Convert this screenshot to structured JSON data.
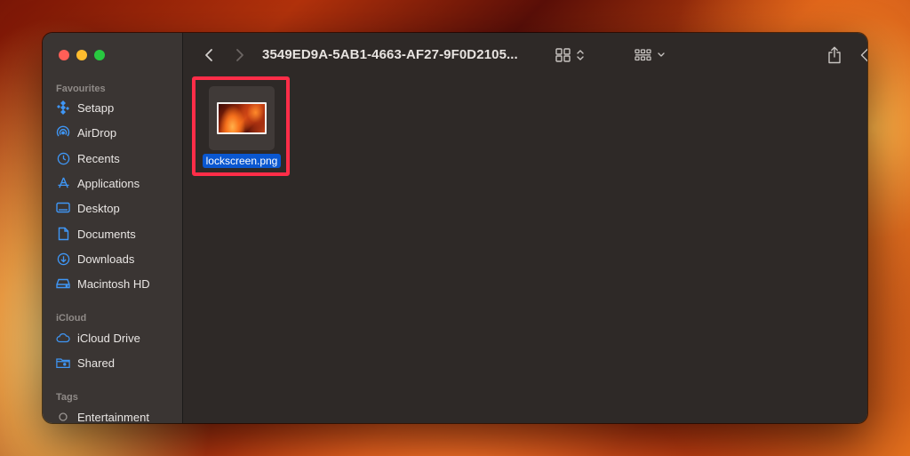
{
  "window": {
    "path_title": "3549ED9A-5AB1-4663-AF27-9F0D2105..."
  },
  "sidebar": {
    "sections": [
      {
        "title": "Favourites",
        "items": [
          {
            "label": "Setapp",
            "icon": "setapp-icon"
          },
          {
            "label": "AirDrop",
            "icon": "airdrop-icon"
          },
          {
            "label": "Recents",
            "icon": "clock-icon"
          },
          {
            "label": "Applications",
            "icon": "applications-icon"
          },
          {
            "label": "Desktop",
            "icon": "desktop-icon"
          },
          {
            "label": "Documents",
            "icon": "document-icon"
          },
          {
            "label": "Downloads",
            "icon": "download-icon"
          },
          {
            "label": "Macintosh HD",
            "icon": "drive-icon"
          }
        ]
      },
      {
        "title": "iCloud",
        "items": [
          {
            "label": "iCloud Drive",
            "icon": "cloud-icon"
          },
          {
            "label": "Shared",
            "icon": "shared-folder-icon"
          }
        ]
      },
      {
        "title": "Tags",
        "items": [
          {
            "label": "Entertainment",
            "icon": "tag-circle-icon"
          }
        ]
      }
    ]
  },
  "files": [
    {
      "name": "lockscreen.png",
      "selected": true
    }
  ],
  "colors": {
    "accent": "#3f96f5",
    "selection": "#0a57d0",
    "highlight_box": "#ff2d48"
  }
}
